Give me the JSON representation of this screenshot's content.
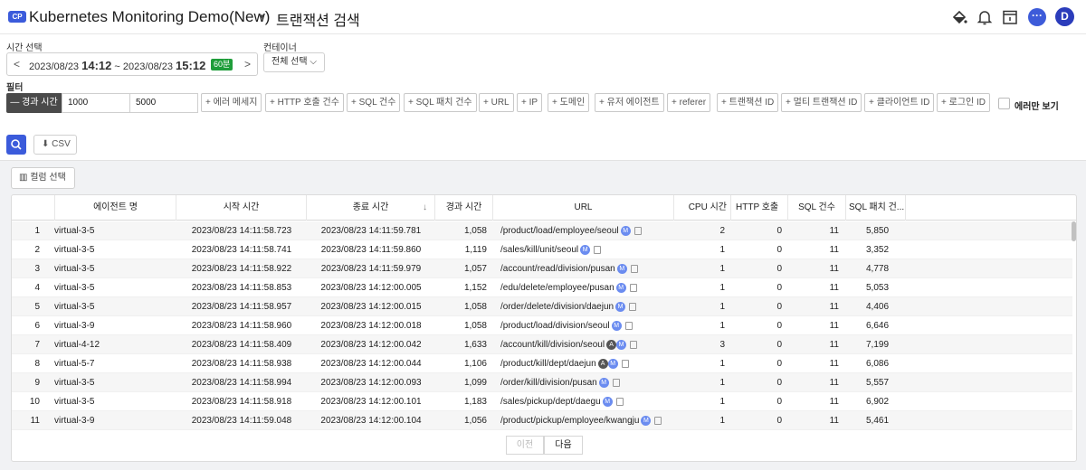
{
  "header": {
    "badge": "CP",
    "project": "Kubernetes Monitoring Demo(New)",
    "caret": "▾",
    "page_title": "트랜잭션 검색",
    "chat_glyph": "···",
    "avatar": "D"
  },
  "time": {
    "label": "시간 선택",
    "prev": "<",
    "next": ">",
    "from_date": "2023/08/23 ",
    "from_time": "14:12",
    "sep": " ~ ",
    "to_date": "2023/08/23 ",
    "to_time": "15:12",
    "duration": "60분"
  },
  "container": {
    "label": "컨테이너",
    "value": "전체 선택 ⌵"
  },
  "filter": {
    "label": "필터",
    "elapsed": "— 경과 시간",
    "min": "1000",
    "max": "5000",
    "chips": [
      "+ 에러 메세지",
      "+ HTTP 호출 건수",
      "+ SQL 건수",
      "+ SQL 패치 건수",
      "+ URL",
      "+ IP",
      "+ 도메인",
      "+ 유저 에이전트",
      "+ referer",
      "+ 트랜잭션 ID",
      "+ 멀티 트랜잭션 ID",
      "+ 클라이언트 ID",
      "+ 로그인 ID"
    ],
    "error_only": "에러만 보기"
  },
  "actions": {
    "csv": "CSV",
    "column_select": "컬럼 선택"
  },
  "table": {
    "headers": [
      "에이전트 명",
      "시작 시간",
      "종료 시간",
      "경과 시간",
      "URL",
      "CPU 시간",
      "HTTP 호출 ...",
      "SQL 건수",
      "SQL 패치 건..."
    ],
    "sort_icon": "↓",
    "rows": [
      {
        "n": "1",
        "agent": "virtual-3-5",
        "start": "2023/08/23 14:11:58.723",
        "end": "2023/08/23 14:11:59.781",
        "elapsed": "1,058",
        "url": "/product/load/employee/seoul",
        "a": false,
        "cpu": "2",
        "http": "0",
        "sql": "11",
        "fetch": "5,850"
      },
      {
        "n": "2",
        "agent": "virtual-3-5",
        "start": "2023/08/23 14:11:58.741",
        "end": "2023/08/23 14:11:59.860",
        "elapsed": "1,119",
        "url": "/sales/kill/unit/seoul",
        "a": false,
        "cpu": "1",
        "http": "0",
        "sql": "11",
        "fetch": "3,352"
      },
      {
        "n": "3",
        "agent": "virtual-3-5",
        "start": "2023/08/23 14:11:58.922",
        "end": "2023/08/23 14:11:59.979",
        "elapsed": "1,057",
        "url": "/account/read/division/pusan",
        "a": false,
        "cpu": "1",
        "http": "0",
        "sql": "11",
        "fetch": "4,778"
      },
      {
        "n": "4",
        "agent": "virtual-3-5",
        "start": "2023/08/23 14:11:58.853",
        "end": "2023/08/23 14:12:00.005",
        "elapsed": "1,152",
        "url": "/edu/delete/employee/pusan",
        "a": false,
        "cpu": "1",
        "http": "0",
        "sql": "11",
        "fetch": "5,053"
      },
      {
        "n": "5",
        "agent": "virtual-3-5",
        "start": "2023/08/23 14:11:58.957",
        "end": "2023/08/23 14:12:00.015",
        "elapsed": "1,058",
        "url": "/order/delete/division/daejun",
        "a": false,
        "cpu": "1",
        "http": "0",
        "sql": "11",
        "fetch": "4,406"
      },
      {
        "n": "6",
        "agent": "virtual-3-9",
        "start": "2023/08/23 14:11:58.960",
        "end": "2023/08/23 14:12:00.018",
        "elapsed": "1,058",
        "url": "/product/load/division/seoul",
        "a": false,
        "cpu": "1",
        "http": "0",
        "sql": "11",
        "fetch": "6,646"
      },
      {
        "n": "7",
        "agent": "virtual-4-12",
        "start": "2023/08/23 14:11:58.409",
        "end": "2023/08/23 14:12:00.042",
        "elapsed": "1,633",
        "url": "/account/kill/division/seoul",
        "a": true,
        "cpu": "3",
        "http": "0",
        "sql": "11",
        "fetch": "7,199"
      },
      {
        "n": "8",
        "agent": "virtual-5-7",
        "start": "2023/08/23 14:11:58.938",
        "end": "2023/08/23 14:12:00.044",
        "elapsed": "1,106",
        "url": "/product/kill/dept/daejun",
        "a": true,
        "cpu": "1",
        "http": "0",
        "sql": "11",
        "fetch": "6,086"
      },
      {
        "n": "9",
        "agent": "virtual-3-5",
        "start": "2023/08/23 14:11:58.994",
        "end": "2023/08/23 14:12:00.093",
        "elapsed": "1,099",
        "url": "/order/kill/division/pusan",
        "a": false,
        "cpu": "1",
        "http": "0",
        "sql": "11",
        "fetch": "5,557"
      },
      {
        "n": "10",
        "agent": "virtual-3-5",
        "start": "2023/08/23 14:11:58.918",
        "end": "2023/08/23 14:12:00.101",
        "elapsed": "1,183",
        "url": "/sales/pickup/dept/daegu",
        "a": false,
        "cpu": "1",
        "http": "0",
        "sql": "11",
        "fetch": "6,902"
      },
      {
        "n": "11",
        "agent": "virtual-3-9",
        "start": "2023/08/23 14:11:59.048",
        "end": "2023/08/23 14:12:00.104",
        "elapsed": "1,056",
        "url": "/product/pickup/employee/kwangju",
        "a": false,
        "cpu": "1",
        "http": "0",
        "sql": "11",
        "fetch": "5,461"
      }
    ],
    "badge_m": "M",
    "badge_a": "A"
  },
  "pagination": {
    "prev": "이전",
    "next": "다음"
  },
  "colors": {
    "accent": "#3b5bdb",
    "badge_green": "#1f9d3a"
  }
}
